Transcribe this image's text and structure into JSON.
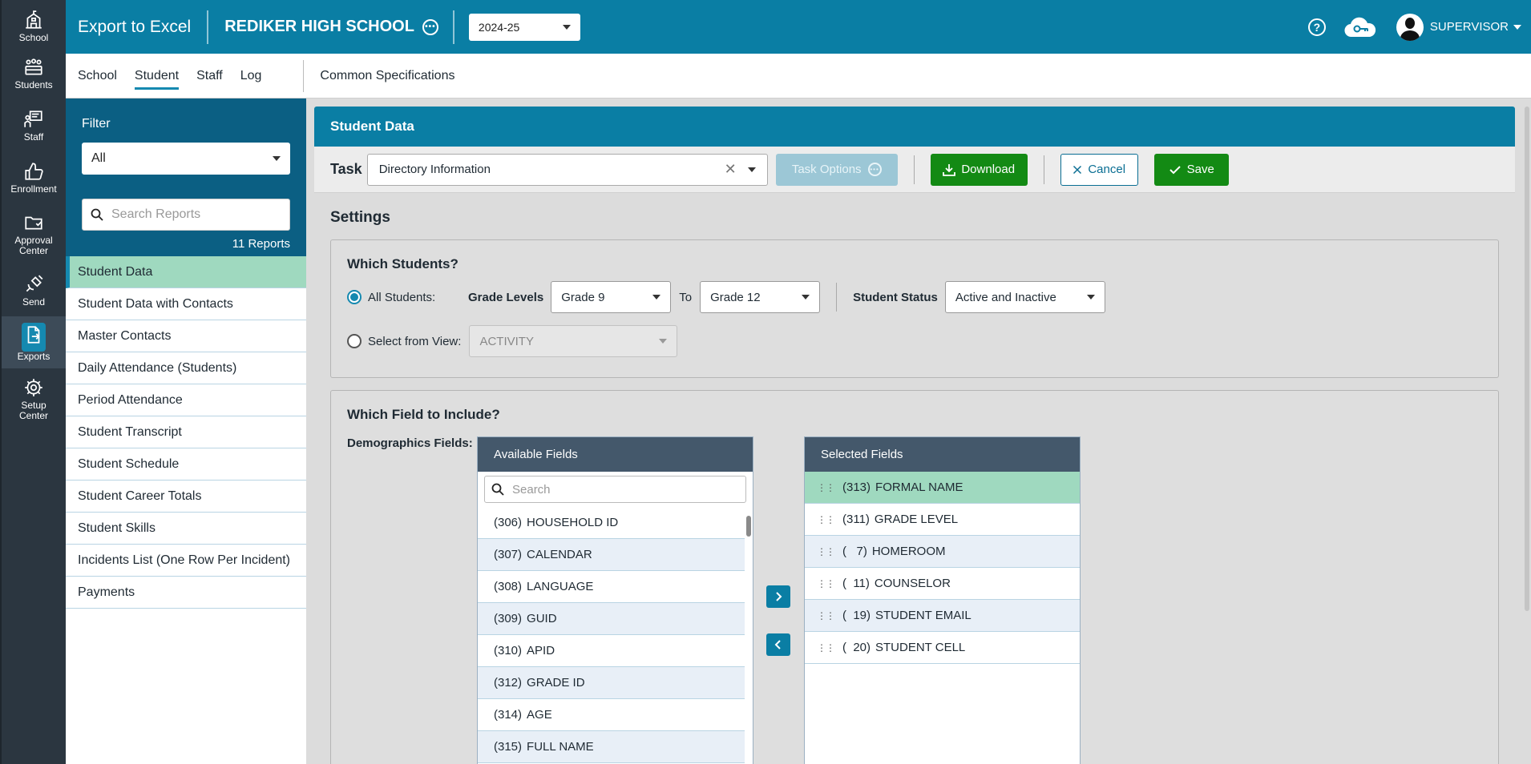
{
  "rail": [
    {
      "id": "school",
      "label": "School",
      "icon": "school-icon"
    },
    {
      "id": "students",
      "label": "Students",
      "icon": "students-icon"
    },
    {
      "id": "staff",
      "label": "Staff",
      "icon": "staff-icon"
    },
    {
      "id": "enrollment",
      "label": "Enrollment",
      "icon": "thumbs-up-icon"
    },
    {
      "id": "approval",
      "label": "Approval Center",
      "icon": "folder-check-icon"
    },
    {
      "id": "send",
      "label": "Send",
      "icon": "satellite-icon"
    },
    {
      "id": "exports",
      "label": "Exports",
      "icon": "export-file-icon"
    },
    {
      "id": "setup",
      "label": "Setup Center",
      "icon": "gear-icon"
    }
  ],
  "header": {
    "title": "Export to Excel",
    "school": "REDIKER HIGH SCHOOL",
    "year": "2024-25",
    "user": "SUPERVISOR"
  },
  "subnav": {
    "tabs": [
      "School",
      "Student",
      "Staff",
      "Log"
    ],
    "active": "Student",
    "extra": "Common Specifications"
  },
  "filter": {
    "label": "Filter",
    "value": "All",
    "search_placeholder": "Search Reports",
    "count": "11 Reports",
    "reports": [
      "Student Data",
      "Student Data with Contacts",
      "Master Contacts",
      "Daily Attendance (Students)",
      "Period Attendance",
      "Student Transcript",
      "Student Schedule",
      "Student Career Totals",
      "Student Skills",
      "Incidents List (One Row Per Incident)",
      "Payments"
    ],
    "active_index": 0
  },
  "main": {
    "title": "Student Data",
    "task_label": "Task",
    "task_value": "Directory Information",
    "task_options": "Task Options",
    "download": "Download",
    "cancel": "Cancel",
    "save": "Save",
    "settings": "Settings"
  },
  "students": {
    "title": "Which Students?",
    "all_label": "All Students:",
    "grade_levels_label": "Grade Levels",
    "grade_from": "Grade 9",
    "to_label": "To",
    "grade_to": "Grade 12",
    "status_label": "Student Status",
    "status_value": "Active and Inactive",
    "view_label": "Select from View:",
    "view_value": "ACTIVITY"
  },
  "fields": {
    "title": "Which Field to Include?",
    "group_label": "Demographics Fields:",
    "available_header": "Available Fields",
    "search_placeholder": "Search",
    "selected_header": "Selected Fields",
    "available": [
      {
        "code": "(306)",
        "name": "HOUSEHOLD ID"
      },
      {
        "code": "(307)",
        "name": "CALENDAR"
      },
      {
        "code": "(308)",
        "name": "LANGUAGE"
      },
      {
        "code": "(309)",
        "name": "GUID"
      },
      {
        "code": "(310)",
        "name": "APID"
      },
      {
        "code": "(312)",
        "name": "GRADE ID"
      },
      {
        "code": "(314)",
        "name": "AGE"
      },
      {
        "code": "(315)",
        "name": "FULL NAME"
      }
    ],
    "selected": [
      {
        "code": "(313)",
        "name": "FORMAL NAME"
      },
      {
        "code": "(311)",
        "name": "GRADE LEVEL"
      },
      {
        "code": "(   7)",
        "name": "HOMEROOM"
      },
      {
        "code": "(  11)",
        "name": "COUNSELOR"
      },
      {
        "code": "(  19)",
        "name": "STUDENT EMAIL"
      },
      {
        "code": "(  20)",
        "name": "STUDENT CELL"
      }
    ]
  },
  "colors": {
    "brand": "#0a7ea4",
    "filter_panel": "#0b5f83",
    "selected_row": "#9fd9bf",
    "success": "#138a14",
    "rail": "#2b3640"
  }
}
